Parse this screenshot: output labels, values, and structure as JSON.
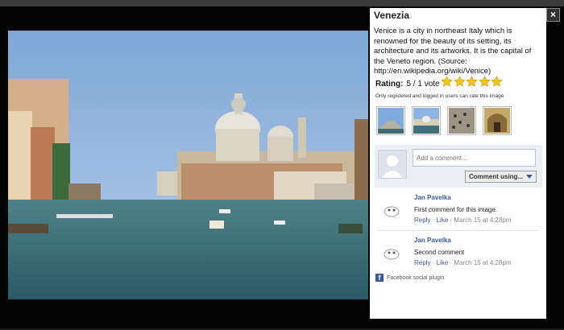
{
  "panel": {
    "title": "Venezia",
    "description": "Venice is a city in northeast Italy which is renowned for the beauty of its setting, its architecture and its artworks. It is the capital of the Veneto region. (Source: http://en.wikipedia.org/wiki/Venice)",
    "rating_label": "Rating:",
    "rating_value": "5 / 1 vote",
    "stars": 5,
    "rating_note": "Only registered and logged in users can rate this image"
  },
  "comment_box": {
    "placeholder": "Add a comment...",
    "button_label": "Comment using..."
  },
  "comments": [
    {
      "author": "Jan Pavelka",
      "text": "First comment for this image.",
      "reply": "Reply",
      "sep": "·",
      "like": "Like",
      "time": "· March 15 at 4:28pm"
    },
    {
      "author": "Jan Pavelka",
      "text": "Second comment",
      "reply": "Reply",
      "sep": "·",
      "like": "Like",
      "time": "· March 15 at 4:28pm"
    }
  ],
  "footer": {
    "plugin_label": "Facebook social plugin"
  },
  "close_icon": "×",
  "colors": {
    "link": "#3b5998",
    "star": "#f5c518",
    "backdrop": "#050505"
  }
}
